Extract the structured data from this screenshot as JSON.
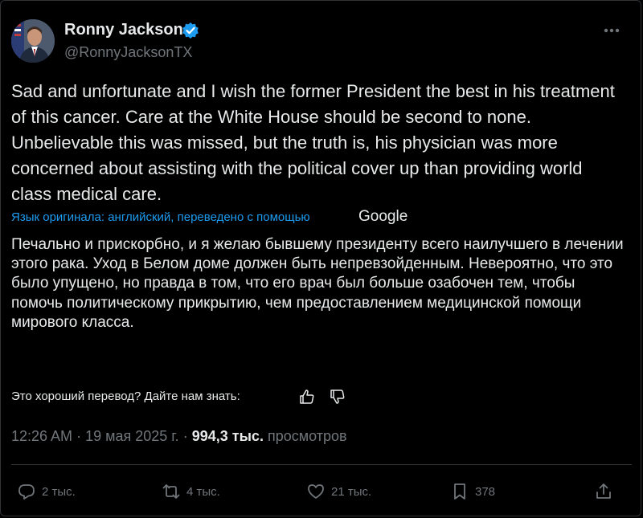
{
  "author": {
    "name": "Ronny Jackson",
    "handle": "@RonnyJacksonTX"
  },
  "tweet": {
    "text": "Sad and unfortunate and I wish the former President the best in his treatment of this cancer. Care at the White House should be second to none. Unbelievable this was missed, but the truth is, his physician was more concerned about assisting with the political cover up than providing world class medical care.",
    "translation_label": "Язык оригинала: английский, переведено с помощью",
    "translation_provider": "Google",
    "translated_text": "Печально и прискорбно, и я желаю бывшему президенту всего наилучшего в лечении этого рака. Уход в Белом доме должен быть непревзойденным. Невероятно, что это было упущено, но правда в том, что его врач был больше озабочен тем, чтобы помочь политическому прикрытию, чем предоставлением медицинской помощи мирового класса.",
    "feedback_prompt": "Это хороший перевод? Дайте нам знать:"
  },
  "meta": {
    "time": "12:26 AM",
    "separator": "·",
    "date": "19 мая 2025 г.",
    "views_count": "994,3 тыс.",
    "views_label": "просмотров"
  },
  "actions": {
    "replies": "2 тыс.",
    "reposts": "4 тыс.",
    "likes": "21 тыс.",
    "bookmarks": "378"
  },
  "colors": {
    "background": "#000000",
    "text": "#e7e9ea",
    "muted": "#71767b",
    "accent": "#1d9bf0"
  }
}
